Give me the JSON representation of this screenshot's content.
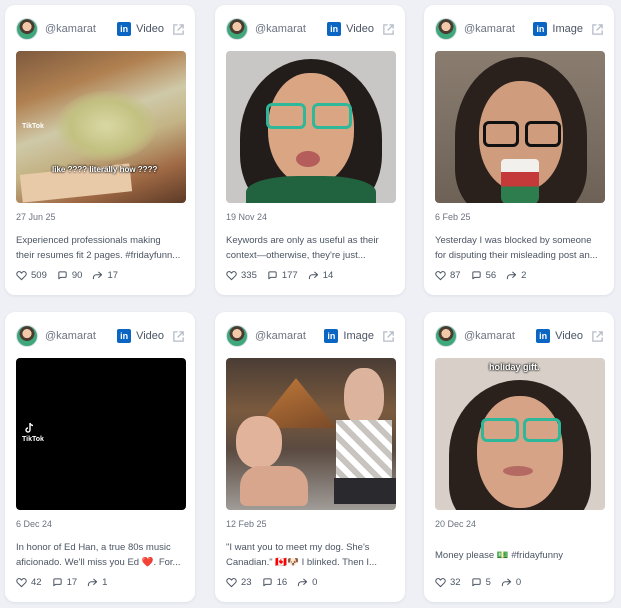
{
  "cards": [
    {
      "handle": "@kamarat",
      "media_type": "Video",
      "date": "27 Jun 25",
      "caption": "Experienced professionals making\ntheir resumes fit 2 pages. #fridayfunn...",
      "likes": "509",
      "comments": "90",
      "reposts": "17",
      "overlay_text": "like ???? literally how ????",
      "tiktok_label": "TikTok"
    },
    {
      "handle": "@kamarat",
      "media_type": "Video",
      "date": "19 Nov 24",
      "caption": "Keywords are only as useful as their\ncontext—otherwise, they're just...",
      "likes": "335",
      "comments": "177",
      "reposts": "14"
    },
    {
      "handle": "@kamarat",
      "media_type": "Image",
      "date": "6 Feb 25",
      "caption": "Yesterday I was blocked by someone\nfor disputing their misleading post an...",
      "likes": "87",
      "comments": "56",
      "reposts": "2"
    },
    {
      "handle": "@kamarat",
      "media_type": "Video",
      "date": "6 Dec 24",
      "caption": "In honor of Ed Han, a true 80s music\naficionado. We'll miss you Ed ❤️. For...",
      "likes": "42",
      "comments": "17",
      "reposts": "1",
      "tiktok_label": "TikTok"
    },
    {
      "handle": "@kamarat",
      "media_type": "Image",
      "date": "12 Feb 25",
      "caption": "\"I want you to meet my dog. She's\nCanadian.\" 🇨🇦🐶 I blinked. Then I...",
      "likes": "23",
      "comments": "16",
      "reposts": "0"
    },
    {
      "handle": "@kamarat",
      "media_type": "Video",
      "date": "20 Dec 24",
      "caption": "Money please 💵 #fridayfunny",
      "likes": "32",
      "comments": "5",
      "reposts": "0",
      "overlay_text": "holiday gift."
    }
  ],
  "colors": {
    "linkedin": "#0a66c2",
    "background": "#eef0f5",
    "card": "#ffffff"
  }
}
